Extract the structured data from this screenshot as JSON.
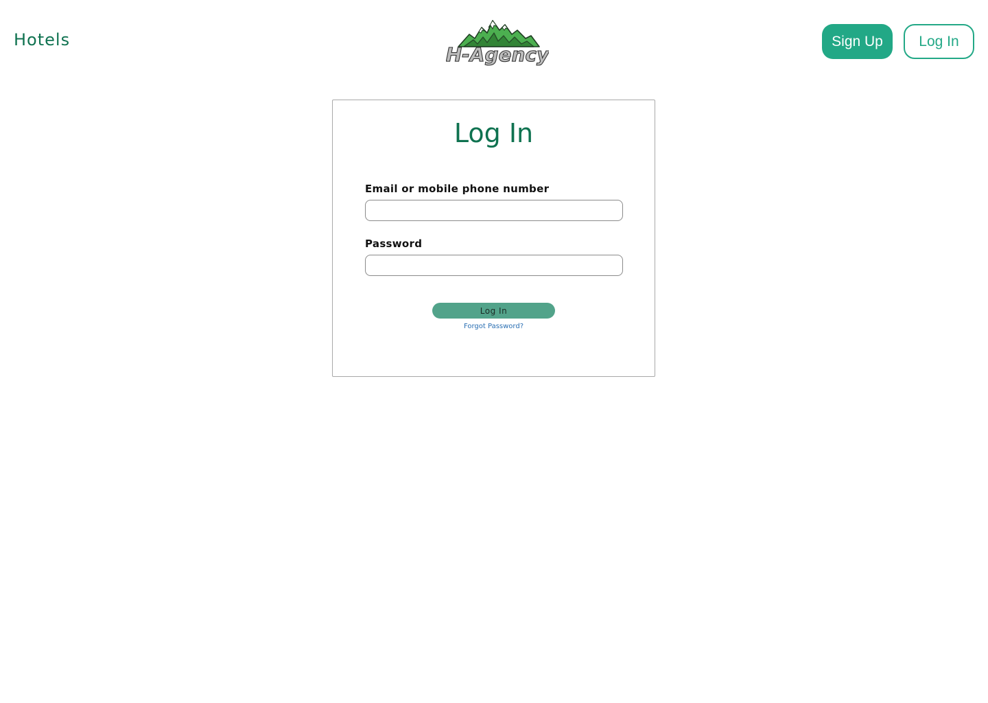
{
  "header": {
    "nav_hotels": "Hotels",
    "logo_text": "H-Agency",
    "signup_label": "Sign Up",
    "login_label": "Log In"
  },
  "login_card": {
    "title": "Log In",
    "email_label": "Email or mobile phone number",
    "email_value": "",
    "password_label": "Password",
    "password_value": "",
    "submit_label": "Log In",
    "forgot_label": "Forgot Password?"
  },
  "colors": {
    "brand_dark": "#0f7250",
    "brand_accent": "#22a886",
    "submit_bg": "#52a38a",
    "link": "#2a6fb3",
    "logo_mountain": "#4caf50"
  },
  "icons": {
    "logo": "mountain-logo-icon"
  }
}
